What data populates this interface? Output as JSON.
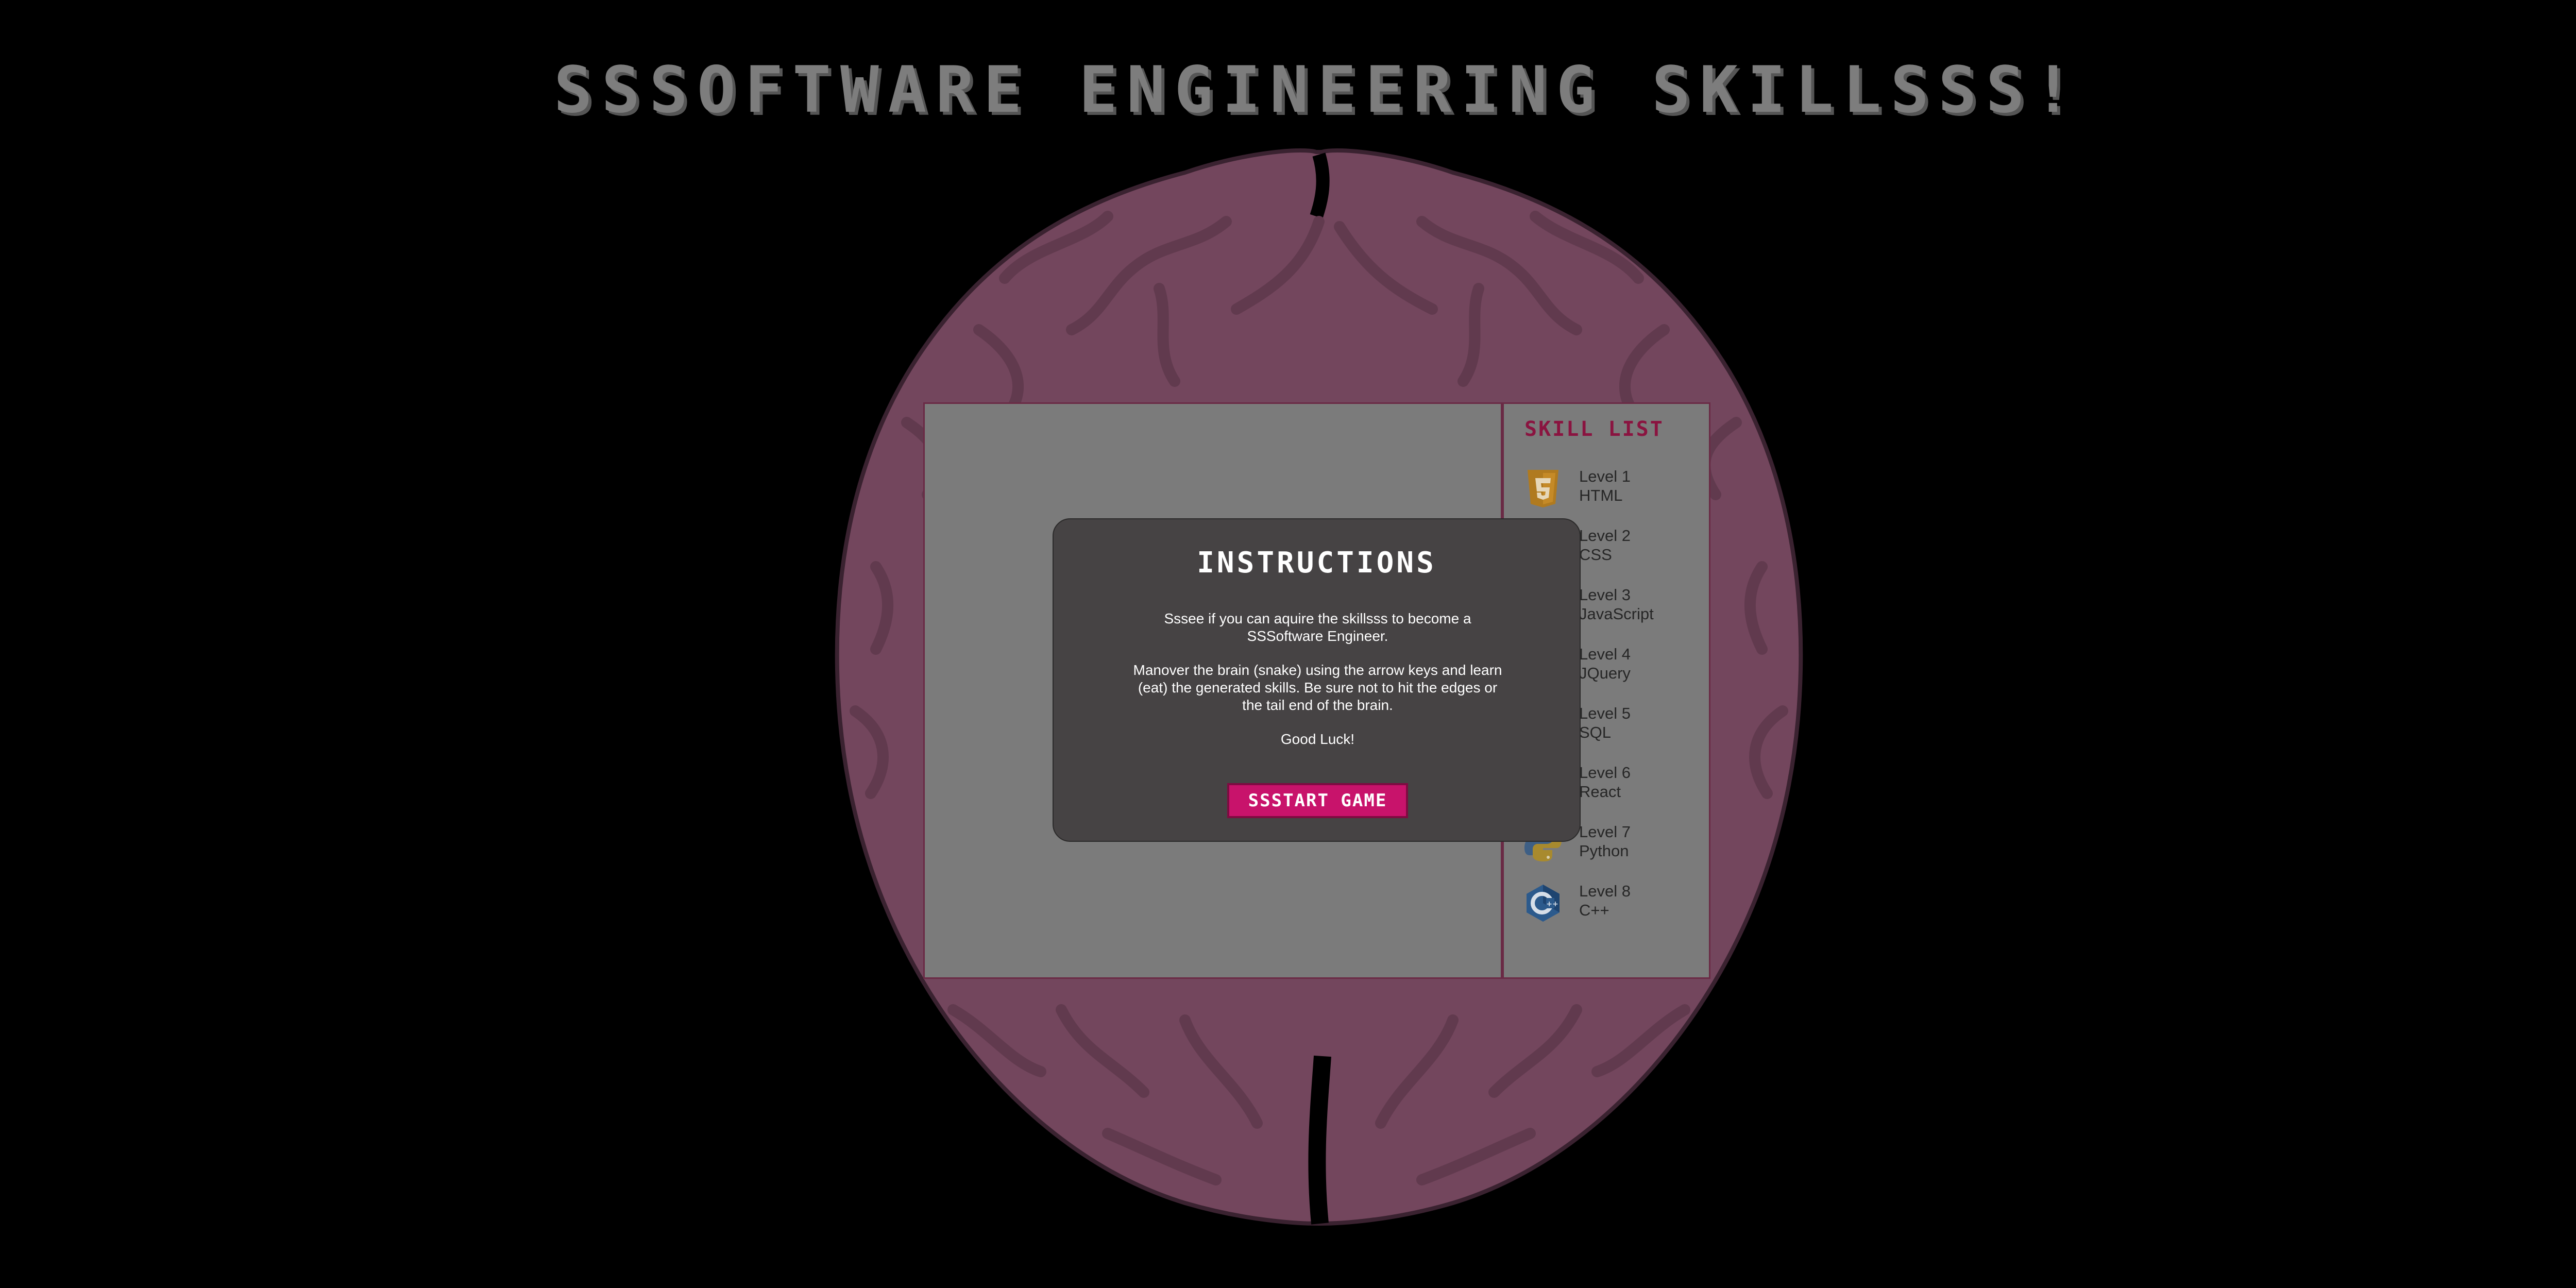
{
  "header": {
    "title": "SSSOFTWARE ENGINEERING SKILLSSS!"
  },
  "colors": {
    "background": "#000000",
    "brain": "#73465d",
    "title": "#7d7d7d",
    "accent": "#c8136b",
    "skill_list_title": "#8a1440",
    "board": "#7b7b7b",
    "modal": "#464344"
  },
  "skill_list": {
    "title": "SKILL LIST",
    "items": [
      {
        "level": "Level 1",
        "name": "HTML",
        "icon": "html5-icon"
      },
      {
        "level": "Level 2",
        "name": "CSS",
        "icon": "css3-icon"
      },
      {
        "level": "Level 3",
        "name": "JavaScript",
        "icon": "html5-icon"
      },
      {
        "level": "Level 4",
        "name": "JQuery",
        "icon": "jquery-icon"
      },
      {
        "level": "Level 5",
        "name": "SQL",
        "icon": "database-icon"
      },
      {
        "level": "Level 6",
        "name": "React",
        "icon": "react-icon"
      },
      {
        "level": "Level 7",
        "name": "Python",
        "icon": "python-icon"
      },
      {
        "level": "Level 8",
        "name": "C++",
        "icon": "cpp-icon"
      }
    ]
  },
  "instructions": {
    "title": "INSTRUCTIONS",
    "paragraph1": "Sssee if you can aquire the skillsss to become a SSSoftware Engineer.",
    "paragraph2": "Manover the brain (snake) using the arrow keys and learn (eat) the generated skills. Be sure not to hit the edges or the tail end of the brain.",
    "paragraph3": "Good Luck!",
    "start_button": "SSSTART GAME"
  }
}
